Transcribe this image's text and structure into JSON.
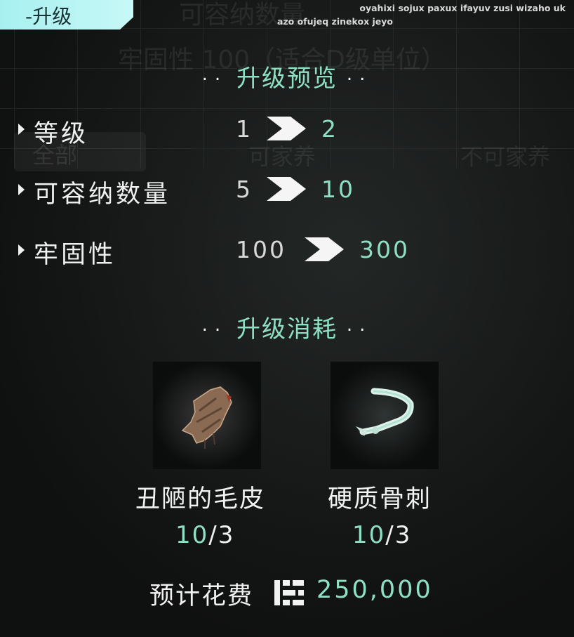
{
  "header": {
    "tab_label": "-升级"
  },
  "corner": {
    "line1": "oyahixi sojux paxux ifayuv zusi wizaho uk",
    "line2": "azo ofujeq zinekox jeyo"
  },
  "background_text": {
    "capacity_title": "可容纳数量",
    "durability_desc": "牢固性 100（适合D级单位）",
    "filter_all": "全部",
    "filter_domestic": "可家养",
    "filter_non_domestic": "不可家养"
  },
  "preview": {
    "title": "升级预览",
    "stats": [
      {
        "label": "等级",
        "from": "1",
        "to": "2"
      },
      {
        "label": "可容纳数量",
        "from": "5",
        "to": "10"
      },
      {
        "label": "牢固性",
        "from": "100",
        "to": "300"
      }
    ]
  },
  "consumption": {
    "title": "升级消耗",
    "items": [
      {
        "name": "丑陋的毛皮",
        "have": "10",
        "need": "/3",
        "icon": "ugly-fur-icon"
      },
      {
        "name": "硬质骨刺",
        "have": "10",
        "need": "/3",
        "icon": "hard-bone-spur-icon"
      }
    ]
  },
  "cost": {
    "label": "预计花费",
    "value": "250,000",
    "icon": "currency-icon"
  },
  "colors": {
    "accent": "#8fe0c2",
    "tab": "#b8f4f3",
    "background": "#1a1c1b"
  }
}
